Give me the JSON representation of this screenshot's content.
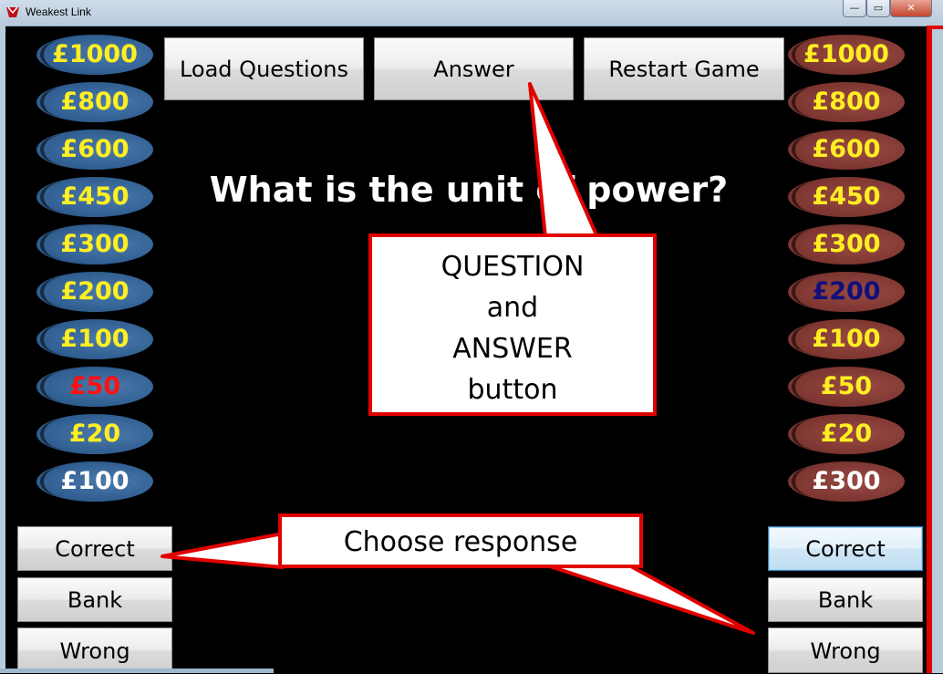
{
  "window": {
    "title": "Weakest Link",
    "min_label": "—",
    "max_label": "▭",
    "close_label": "✕"
  },
  "toolbar": {
    "load_label": "Load Questions",
    "answer_label": "Answer",
    "restart_label": "Restart Game"
  },
  "question": "What is the unit of power?",
  "left_chain": [
    {
      "value": "£1000",
      "color": "#ffef22"
    },
    {
      "value": "£800",
      "color": "#ffef22"
    },
    {
      "value": "£600",
      "color": "#ffef22"
    },
    {
      "value": "£450",
      "color": "#ffef22"
    },
    {
      "value": "£300",
      "color": "#ffef22"
    },
    {
      "value": "£200",
      "color": "#ffef22"
    },
    {
      "value": "£100",
      "color": "#ffef22"
    },
    {
      "value": "£50",
      "color": "#ff1010"
    },
    {
      "value": "£20",
      "color": "#ffef22"
    },
    {
      "value": "£100",
      "color": "#ffffff"
    }
  ],
  "right_chain": [
    {
      "value": "£1000",
      "color": "#ffef22"
    },
    {
      "value": "£800",
      "color": "#ffef22"
    },
    {
      "value": "£600",
      "color": "#ffef22"
    },
    {
      "value": "£450",
      "color": "#ffef22"
    },
    {
      "value": "£300",
      "color": "#ffef22"
    },
    {
      "value": "£200",
      "color": "#10107a"
    },
    {
      "value": "£100",
      "color": "#ffef22"
    },
    {
      "value": "£50",
      "color": "#ffef22"
    },
    {
      "value": "£20",
      "color": "#ffef22"
    },
    {
      "value": "£300",
      "color": "#ffffff"
    }
  ],
  "left_controls": {
    "correct": "Correct",
    "bank": "Bank",
    "wrong": "Wrong"
  },
  "right_controls": {
    "correct": "Correct",
    "bank": "Bank",
    "wrong": "Wrong"
  },
  "callouts": {
    "qa_lines": [
      "QUESTION",
      "and",
      "ANSWER",
      "button"
    ],
    "response": "Choose response"
  }
}
